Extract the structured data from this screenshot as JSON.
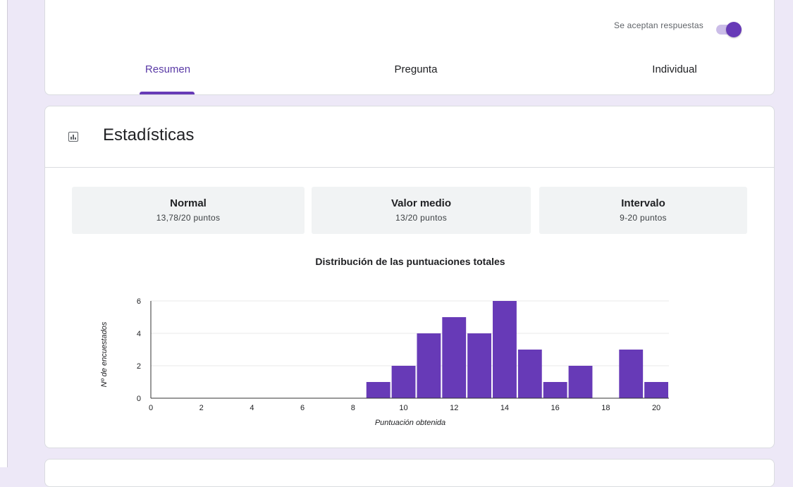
{
  "header": {
    "accepting_label": "Se aceptan respuestas",
    "accepting_on": true,
    "tabs": [
      {
        "label": "Resumen",
        "active": true
      },
      {
        "label": "Pregunta",
        "active": false
      },
      {
        "label": "Individual",
        "active": false
      }
    ]
  },
  "stats": {
    "title": "Estadísticas",
    "icon": "bar-chart-icon",
    "metrics": [
      {
        "label": "Normal",
        "value": "13,78/20 puntos"
      },
      {
        "label": "Valor medio",
        "value": "13/20 puntos"
      },
      {
        "label": "Intervalo",
        "value": "9-20 puntos"
      }
    ]
  },
  "chart_data": {
    "type": "bar",
    "title": "Distribución de las puntuaciones totales",
    "xlabel": "Puntuación obtenida",
    "ylabel": "Nº de encuestados",
    "x": [
      9,
      10,
      11,
      12,
      13,
      14,
      15,
      16,
      17,
      18,
      19,
      20
    ],
    "values": [
      1,
      2,
      4,
      5,
      4,
      6,
      3,
      1,
      2,
      0,
      3,
      1
    ],
    "xlim": [
      0,
      20.5
    ],
    "ylim": [
      0,
      6
    ],
    "xticks": [
      0,
      2,
      4,
      6,
      8,
      10,
      12,
      14,
      16,
      18,
      20
    ],
    "yticks": [
      0,
      2,
      4,
      6
    ],
    "grid": true,
    "bar_color": "#673ab7"
  },
  "colors": {
    "accent": "#673ab7",
    "page_background": "#ede8f7"
  }
}
